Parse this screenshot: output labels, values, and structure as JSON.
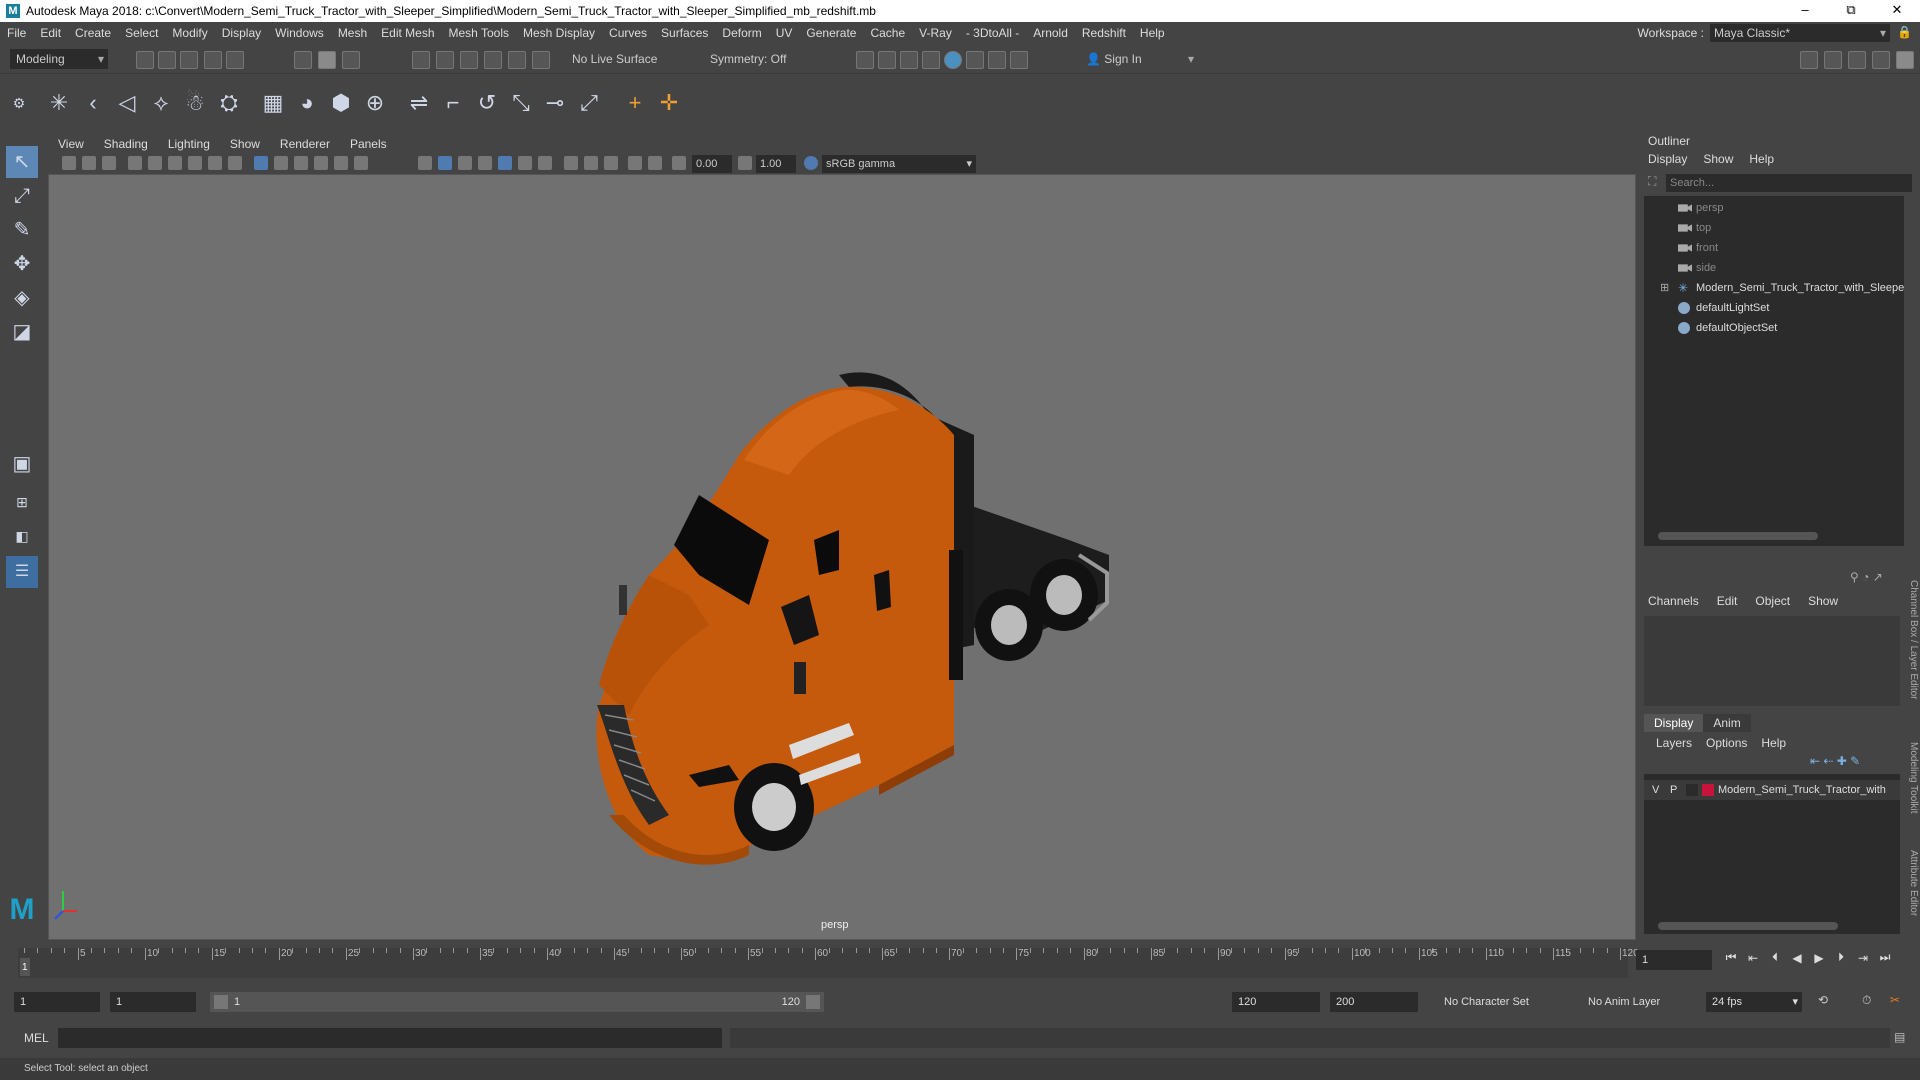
{
  "titlebar": {
    "title": "Autodesk Maya 2018: c:\\Convert\\Modern_Semi_Truck_Tractor_with_Sleeper_Simplified\\Modern_Semi_Truck_Tractor_with_Sleeper_Simplified_mb_redshift.mb",
    "minimize": "–",
    "maximize": "⧉",
    "close": "✕"
  },
  "menubar": {
    "items": [
      "File",
      "Edit",
      "Create",
      "Select",
      "Modify",
      "Display",
      "Windows",
      "Mesh",
      "Edit Mesh",
      "Mesh Tools",
      "Mesh Display",
      "Curves",
      "Surfaces",
      "Deform",
      "UV",
      "Generate",
      "Cache",
      "V-Ray",
      "- 3DtoAll -",
      "Arnold",
      "Redshift",
      "Help"
    ],
    "workspace_label": "Workspace :",
    "workspace_value": "Maya Classic*"
  },
  "statusline": {
    "menuset": "Modeling",
    "live_surface": "No Live Surface",
    "symmetry": "Symmetry: Off",
    "sign_in": "Sign In"
  },
  "viewport": {
    "menu": [
      "View",
      "Shading",
      "Lighting",
      "Show",
      "Renderer",
      "Panels"
    ],
    "exposure": "0.00",
    "gamma": "1.00",
    "color_space": "sRGB gamma",
    "camera_label": "persp"
  },
  "outliner": {
    "title": "Outliner",
    "menu": [
      "Display",
      "Show",
      "Help"
    ],
    "search_placeholder": "Search...",
    "items": [
      {
        "label": "persp",
        "icon": "camera-icon",
        "dim": true
      },
      {
        "label": "top",
        "icon": "camera-icon",
        "dim": true
      },
      {
        "label": "front",
        "icon": "camera-icon",
        "dim": true
      },
      {
        "label": "side",
        "icon": "camera-icon",
        "dim": true
      },
      {
        "label": "Modern_Semi_Truck_Tractor_with_Sleepe",
        "icon": "group-icon",
        "dim": false
      },
      {
        "label": "defaultLightSet",
        "icon": "set-icon",
        "dim": false
      },
      {
        "label": "defaultObjectSet",
        "icon": "set-icon",
        "dim": false
      }
    ]
  },
  "channelbox": {
    "menu": [
      "Channels",
      "Edit",
      "Object",
      "Show"
    ]
  },
  "layereditor": {
    "tabs": [
      "Display",
      "Anim"
    ],
    "menu": [
      "Layers",
      "Options",
      "Help"
    ],
    "layer": {
      "v": "V",
      "p": "P",
      "name": "Modern_Semi_Truck_Tractor_with",
      "color": "#c8143c"
    }
  },
  "side_tabs": [
    "Channel Box / Layer Editor",
    "Modeling Toolkit",
    "Attribute Editor"
  ],
  "timeslider": {
    "labels": [
      "5",
      "10",
      "15",
      "20",
      "25",
      "30",
      "35",
      "40",
      "45",
      "50",
      "55",
      "60",
      "65",
      "70",
      "75",
      "80",
      "85",
      "90",
      "95",
      "100",
      "105",
      "110",
      "115",
      "120"
    ],
    "current_frame_marker": "1",
    "current_frame": "1"
  },
  "rangeslider": {
    "start": "1",
    "start_inner": "1",
    "range_start": "1",
    "range_end": "120",
    "end_inner": "120",
    "end": "200",
    "character_set": "No Character Set",
    "anim_layer": "No Anim Layer",
    "fps": "24 fps"
  },
  "cmdline": {
    "label": "MEL"
  },
  "helpline": {
    "text": "Select Tool: select an object"
  },
  "colors": {
    "truck_body": "#c55a0c",
    "viewport_bg": "#707070",
    "accent": "#5d88b5"
  }
}
